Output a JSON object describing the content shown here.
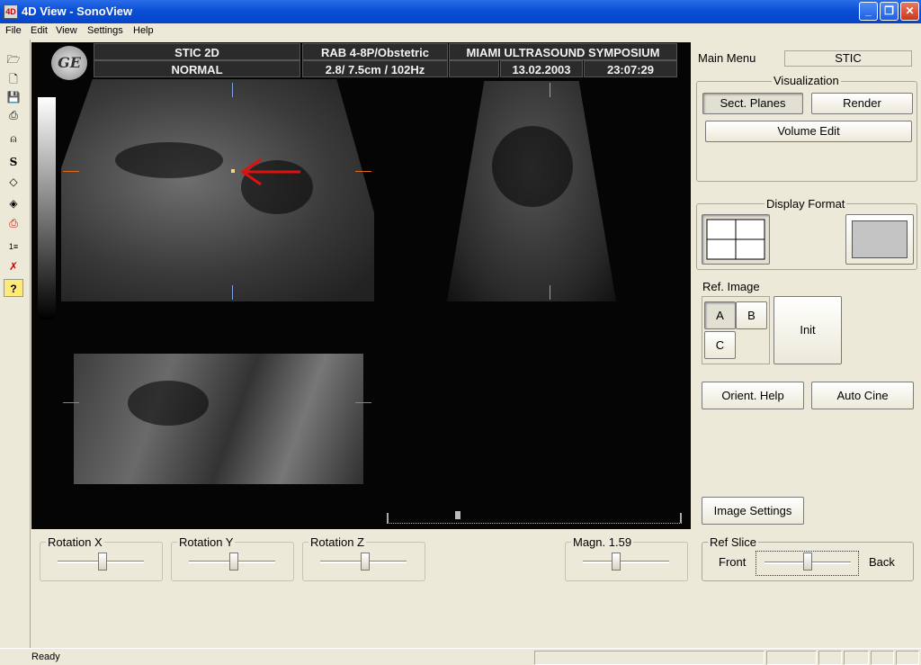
{
  "window": {
    "title": "4D View - SonoView"
  },
  "menu": {
    "items": [
      "File",
      "Edit",
      "View",
      "Settings",
      "Help"
    ]
  },
  "toolbar": {
    "icons": [
      "open-folder-icon",
      "new-file-icon",
      "save-icon",
      "print-icon",
      "person-icon",
      "s-icon",
      "rotate-icon",
      "diamond-icon",
      "print-color-icon",
      "measure-icon",
      "report-icon",
      "help-icon"
    ],
    "s_label": "S",
    "help_label": "?"
  },
  "viewer": {
    "logo": "GE",
    "header": {
      "mode": "STIC 2D",
      "mode2": "NORMAL",
      "probe": "RAB 4-8P/Obstetric",
      "params": "2.8/ 7.5cm / 102Hz",
      "institution": "MIAMI ULTRASOUND SYMPOSIUM",
      "date": "13.02.2003",
      "time": "23:07:29"
    }
  },
  "panel": {
    "main_menu_label": "Main Menu",
    "main_menu_value": "STIC",
    "visualization": {
      "label": "Visualization",
      "sect_planes": "Sect. Planes",
      "render": "Render",
      "volume_edit": "Volume Edit"
    },
    "display_format": {
      "label": "Display Format"
    },
    "ref_image": {
      "label": "Ref. Image",
      "a": "A",
      "b": "B",
      "c": "C",
      "init": "Init"
    },
    "orient_help": "Orient. Help",
    "auto_cine": "Auto Cine",
    "image_settings": "Image Settings",
    "ref_slice": {
      "label": "Ref Slice",
      "front": "Front",
      "back": "Back"
    }
  },
  "controls": {
    "rotation_x": "Rotation X",
    "rotation_y": "Rotation Y",
    "rotation_z": "Rotation Z",
    "magn": "Magn. 1.59"
  },
  "status": {
    "text": "Ready"
  },
  "colors": {
    "accent": "#0a4fd6",
    "marker_orange": "#e26b1a",
    "arrow_red": "#e01010"
  }
}
